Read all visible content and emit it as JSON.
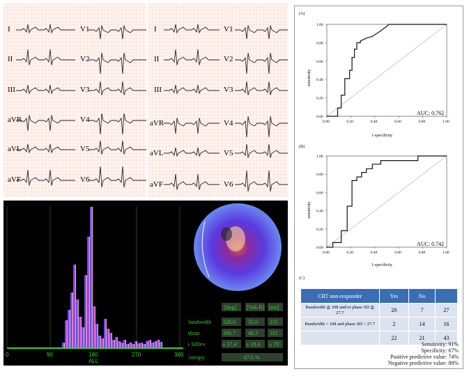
{
  "ecg": {
    "left_panel_1": [
      "I",
      "II",
      "III",
      "aVR",
      "aVL",
      "aVF"
    ],
    "right_panel_1": [
      "V1",
      "V2",
      "V3",
      "V4",
      "V5",
      "V6"
    ],
    "left_panel_2": [
      "I",
      "II",
      "III",
      "aVR",
      "aVL",
      "aVF"
    ],
    "right_panel_2": [
      "V1",
      "V2",
      "V3",
      "V4",
      "V5",
      "V6"
    ]
  },
  "histogram": {
    "x_ticks": [
      "0",
      "90",
      "180",
      "270",
      "360"
    ],
    "x_label": "ALL",
    "colors": {
      "bg": "#000000",
      "grid": "#2a6a2a",
      "axis": "#32d232"
    }
  },
  "phase_table": {
    "headers": [
      "[deg]",
      "[%R-R]",
      "[ms]"
    ],
    "rows": [
      {
        "label": "Bandwidth",
        "v1": "126.0",
        "v2": "35.0",
        "v3": "235"
      },
      {
        "label": "Mean",
        "v1": "166.7",
        "v2": "46.3",
        "v3": "311"
      },
      {
        "label": "± StDev",
        "v1": "± 37.4",
        "v2": "± 10.4",
        "v3": "± 70"
      }
    ],
    "entropy_label": "Entropy",
    "entropy_value": "67.6 %"
  },
  "chart_data": [
    {
      "type": "line",
      "panel": "(A)",
      "xlabel": "1-specificity",
      "ylabel": "sensitivity",
      "xlim": [
        0,
        1
      ],
      "ylim": [
        0,
        1
      ],
      "x_ticks": [
        "0.00",
        "0.20",
        "0.40",
        "0.60",
        "0.80",
        "1.00"
      ],
      "y_ticks": [
        "0.00",
        "0.20",
        "0.40",
        "0.60",
        "0.80",
        "1.00"
      ],
      "annotation": "AUC: 0.762",
      "x": [
        0,
        0.09,
        0.09,
        0.12,
        0.12,
        0.15,
        0.15,
        0.19,
        0.19,
        0.21,
        0.21,
        0.23,
        0.23,
        0.25,
        0.25,
        0.28,
        0.28,
        0.33,
        0.38,
        0.45,
        0.52,
        0.6,
        0.7,
        0.8,
        0.9,
        1.0
      ],
      "y": [
        0,
        0,
        0.09,
        0.09,
        0.23,
        0.23,
        0.41,
        0.41,
        0.5,
        0.5,
        0.64,
        0.64,
        0.73,
        0.73,
        0.8,
        0.8,
        0.82,
        0.85,
        0.87,
        0.93,
        1.0,
        1.0,
        1.0,
        1.0,
        1.0,
        1.0
      ]
    },
    {
      "type": "line",
      "panel": "(B)",
      "xlabel": "1-specificity",
      "ylabel": "sensitivity",
      "xlim": [
        0,
        1
      ],
      "ylim": [
        0,
        1
      ],
      "x_ticks": [
        "0.00",
        "0.20",
        "0.40",
        "0.60",
        "0.80",
        "1.00"
      ],
      "y_ticks": [
        "0.00",
        "0.20",
        "0.40",
        "0.60",
        "0.80",
        "1.00"
      ],
      "annotation": "AUC: 0.742",
      "x": [
        0,
        0.05,
        0.05,
        0.12,
        0.12,
        0.17,
        0.17,
        0.21,
        0.21,
        0.25,
        0.25,
        0.29,
        0.29,
        0.33,
        0.33,
        0.38,
        0.38,
        0.45,
        0.45,
        0.52,
        0.6,
        0.7,
        0.76,
        0.76,
        0.85,
        1.0
      ],
      "y": [
        0,
        0,
        0.05,
        0.05,
        0.18,
        0.18,
        0.45,
        0.45,
        0.73,
        0.73,
        0.77,
        0.77,
        0.82,
        0.82,
        0.86,
        0.86,
        0.91,
        0.91,
        0.95,
        0.95,
        0.95,
        0.95,
        0.95,
        1.0,
        1.0,
        1.0
      ]
    }
  ],
  "contingency": {
    "panel": "(C)",
    "headers": [
      "CRT non-responder",
      "Yes",
      "No",
      ""
    ],
    "rows": [
      {
        "label": "Bandwidth ≧ 108 and/or phase SD ≧ 27.7",
        "yes": "20",
        "no": "7",
        "total": "27"
      },
      {
        "label": "Bandwidth < 108 and phase SD < 27.7",
        "yes": "2",
        "no": "14",
        "total": "16"
      },
      {
        "label": "",
        "yes": "22",
        "no": "21",
        "total": "43"
      }
    ]
  },
  "stats": {
    "sensitivity": "Sensitivity: 91%",
    "specificity": "Specificity: 67%",
    "ppv": "Positive predictive value: 74%",
    "npv": "Negative predictive value: 88%"
  }
}
